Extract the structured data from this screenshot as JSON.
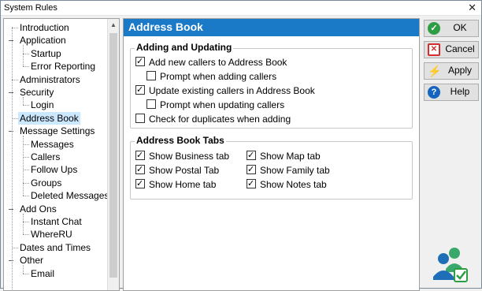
{
  "window": {
    "title": "System Rules"
  },
  "tree": [
    {
      "label": "Introduction",
      "level": 0
    },
    {
      "label": "Application",
      "level": 0,
      "expanded": true
    },
    {
      "label": "Startup",
      "level": 1
    },
    {
      "label": "Error Reporting",
      "level": 1
    },
    {
      "label": "Administrators",
      "level": 0
    },
    {
      "label": "Security",
      "level": 0,
      "expanded": true
    },
    {
      "label": "Login",
      "level": 1
    },
    {
      "label": "Address Book",
      "level": 0,
      "selected": true
    },
    {
      "label": "Message Settings",
      "level": 0,
      "expanded": true
    },
    {
      "label": "Messages",
      "level": 1
    },
    {
      "label": "Callers",
      "level": 1
    },
    {
      "label": "Follow Ups",
      "level": 1
    },
    {
      "label": "Groups",
      "level": 1
    },
    {
      "label": "Deleted Messages",
      "level": 1
    },
    {
      "label": "Add Ons",
      "level": 0,
      "expanded": true
    },
    {
      "label": "Instant Chat",
      "level": 1
    },
    {
      "label": "WhereRU",
      "level": 1
    },
    {
      "label": "Dates and Times",
      "level": 0
    },
    {
      "label": "Other",
      "level": 0,
      "expanded": true
    },
    {
      "label": "Email",
      "level": 1
    }
  ],
  "panel": {
    "title": "Address Book",
    "adding": {
      "title": "Adding and Updating",
      "add_new": {
        "label": "Add new callers to Address Book",
        "checked": true
      },
      "prompt_adding": {
        "label": "Prompt when adding callers",
        "checked": false
      },
      "update_existing": {
        "label": "Update existing callers in Address Book",
        "checked": true
      },
      "prompt_updating": {
        "label": "Prompt when updating callers",
        "checked": false
      },
      "check_dupes": {
        "label": "Check for duplicates when adding",
        "checked": false
      }
    },
    "tabs": {
      "title": "Address Book Tabs",
      "business": {
        "label": "Show Business tab",
        "checked": true
      },
      "postal": {
        "label": "Show Postal Tab",
        "checked": true
      },
      "home": {
        "label": "Show Home tab",
        "checked": true
      },
      "map": {
        "label": "Show Map tab",
        "checked": true
      },
      "family": {
        "label": "Show Family tab",
        "checked": true
      },
      "notes": {
        "label": "Show Notes tab",
        "checked": true
      }
    }
  },
  "buttons": {
    "ok": "OK",
    "cancel": "Cancel",
    "apply": "Apply",
    "help": "Help"
  },
  "colors": {
    "header": "#1a7ac8",
    "selected": "#cce8ff"
  }
}
